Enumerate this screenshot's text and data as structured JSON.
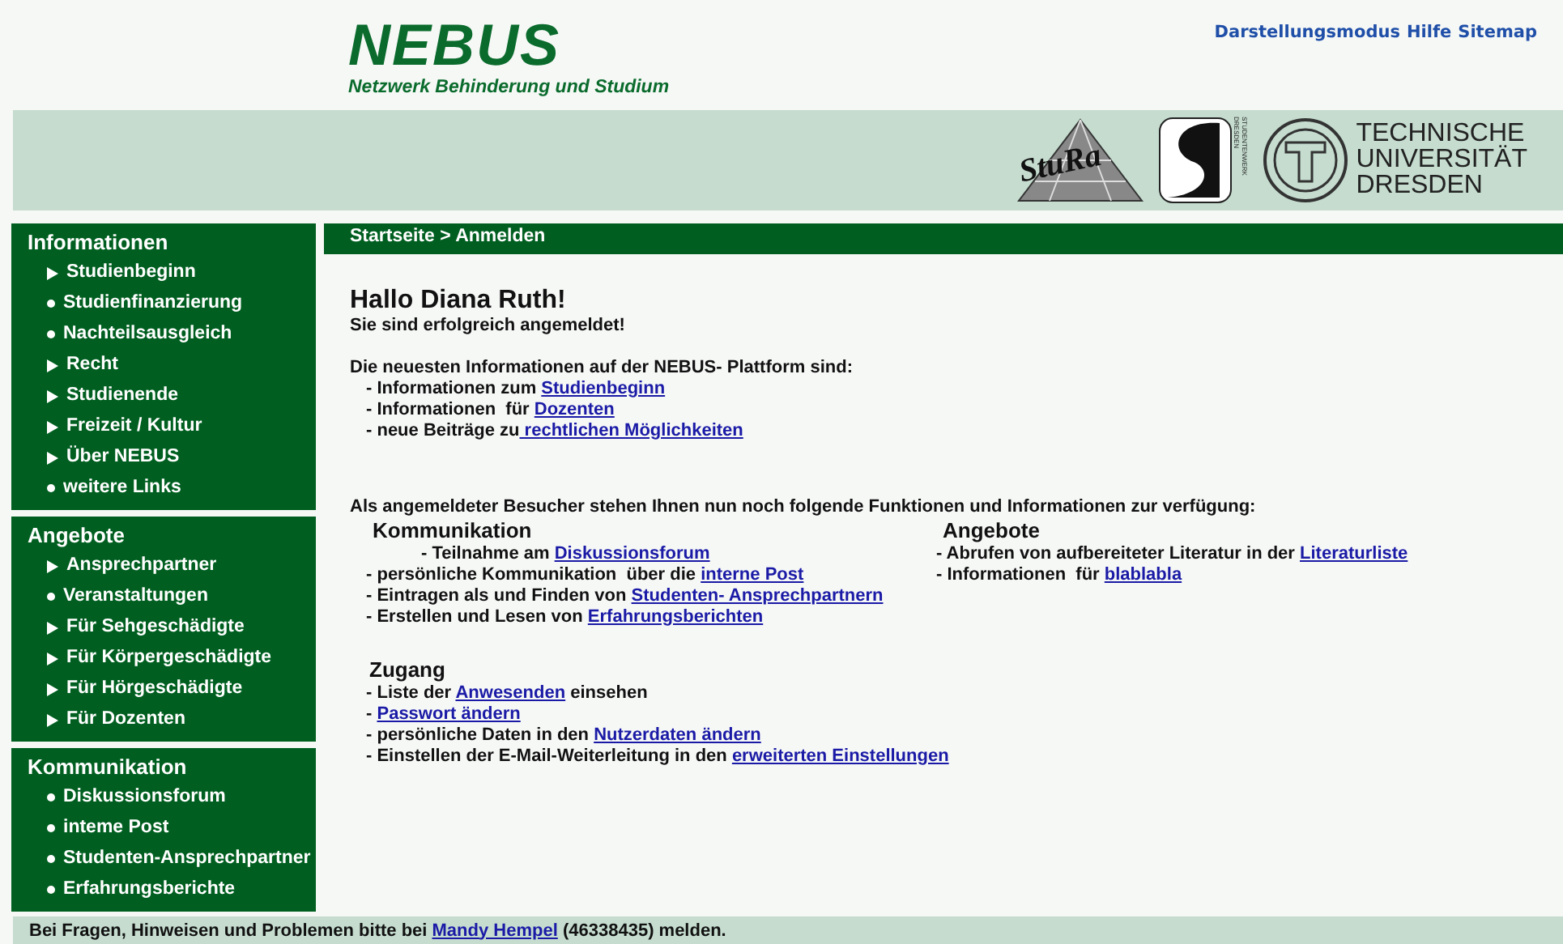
{
  "header": {
    "logo": "NEBUS",
    "tagline": "Netzwerk Behinderung und Studium",
    "top_links": [
      "Darstellungsmodus",
      "Hilfe",
      "Sitemap"
    ]
  },
  "banner": {
    "stura_logo": "StuRa",
    "studentenwerk_logo": "STUDENTENWERK DRESDEN",
    "tu_logo": [
      "TECHNISCHE",
      "UNIVERSITÄT",
      "DRESDEN"
    ]
  },
  "sidebar": [
    {
      "title": "Informationen",
      "items": [
        {
          "label": "Studienbeginn",
          "kind": "arrow"
        },
        {
          "label": "Studienfinanzierung",
          "kind": "bullet"
        },
        {
          "label": "Nachteilsausgleich",
          "kind": "bullet"
        },
        {
          "label": "Recht",
          "kind": "arrow"
        },
        {
          "label": "Studienende",
          "kind": "arrow"
        },
        {
          "label": "Freizeit / Kultur",
          "kind": "arrow"
        },
        {
          "label": "Über NEBUS",
          "kind": "arrow"
        },
        {
          "label": "weitere Links",
          "kind": "bullet"
        }
      ]
    },
    {
      "title": "Angebote",
      "items": [
        {
          "label": "Ansprechpartner",
          "kind": "arrow"
        },
        {
          "label": "Veranstaltungen",
          "kind": "bullet"
        },
        {
          "label": "Für Sehgeschädigte",
          "kind": "arrow"
        },
        {
          "label": "Für Körpergeschädigte",
          "kind": "arrow"
        },
        {
          "label": "Für Hörgeschädigte",
          "kind": "arrow"
        },
        {
          "label": "Für Dozenten",
          "kind": "arrow"
        }
      ]
    },
    {
      "title": "Kommunikation",
      "items": [
        {
          "label": "Diskussionsforum",
          "kind": "bullet"
        },
        {
          "label": "inteme Post",
          "kind": "bullet"
        },
        {
          "label": "Studenten-Ansprechpartner",
          "kind": "bullet"
        },
        {
          "label": "Erfahrungsberichte",
          "kind": "bullet"
        }
      ]
    }
  ],
  "breadcrumb": "Startseite > Anmelden",
  "greeting": "Hallo Diana Ruth!",
  "status": "Sie sind erfolgreich angemeldet!",
  "news_intro": "Die neuesten Informationen auf der NEBUS- Plattform sind:",
  "news": [
    {
      "text": "- Informationen zum ",
      "link": "Studienbeginn"
    },
    {
      "text": "- Informationen  für ",
      "link": "Dozenten"
    },
    {
      "text": "- neue Beiträge zu",
      "link": " rechtlichen Möglichkeiten"
    }
  ],
  "functions_intro": "Als angemeldeter Besucher stehen Ihnen nun noch folgende Funktionen und Informationen zur verfügung:",
  "groups": [
    {
      "title": "Kommunikation",
      "lines": [
        {
          "text": "- Teilnahme am ",
          "link": "Diskussionsforum",
          "indent": true
        },
        {
          "text": "- persönliche Kommunikation  über die ",
          "link": "interne Post"
        },
        {
          "text": "- Eintragen als und Finden von ",
          "link": "Studenten- Ansprechpartnern"
        },
        {
          "text": "- Erstellen und Lesen von ",
          "link": "Erfahrungsberichten"
        }
      ]
    },
    {
      "title": "Angebote",
      "lines": [
        {
          "text": "- Abrufen von aufbereiteter Literatur in der ",
          "link": "Literaturliste"
        },
        {
          "text": "- Informationen  für ",
          "link": "blablabla"
        }
      ]
    },
    {
      "title": "Zugang",
      "lines": [
        {
          "text": "- Liste der ",
          "link": "Anwesenden",
          "after": " einsehen"
        },
        {
          "text": "- ",
          "link": "Passwort ändern"
        },
        {
          "text": "- persönliche Daten in den ",
          "link": "Nutzerdaten ändern"
        },
        {
          "text": "- Einstellen der E-Mail-Weiterleitung in den ",
          "link": "erweiterten Einstellungen"
        }
      ]
    }
  ],
  "footer": {
    "text": "Bei Fragen, Hinweisen und Problemen bitte bei ",
    "link": "Mandy Hempel",
    "after": " (46338435) melden."
  }
}
